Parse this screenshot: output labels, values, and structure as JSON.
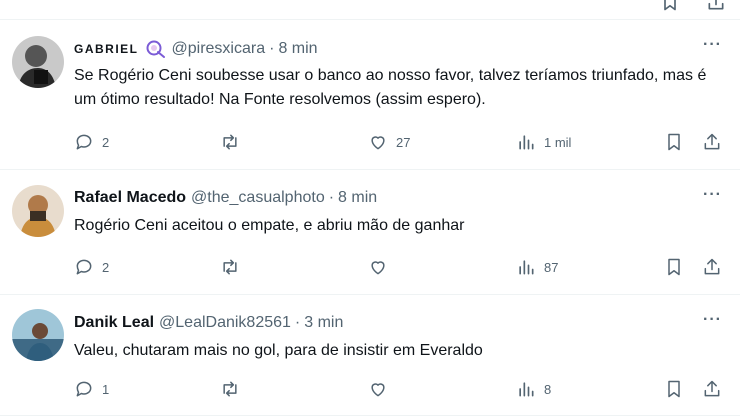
{
  "tweets": [
    {
      "name": "GABRIEL",
      "handle": "@piresxicara",
      "separator": "·",
      "time": "8 min",
      "text": "Se Rogério Ceni soubesse usar o banco ao nosso favor, talvez teríamos triunfado, mas é um ótimo resultado! Na Fonte resolvemos (assim espero).",
      "replies": "2",
      "retweets": "",
      "likes": "27",
      "views": "1 mil",
      "more_label": "···"
    },
    {
      "name": "Rafael Macedo",
      "handle": "@the_casualphoto",
      "separator": "·",
      "time": "8 min",
      "text": "Rogério Ceni aceitou o empate, e abriu mão de ganhar",
      "replies": "2",
      "retweets": "",
      "likes": "",
      "views": "87",
      "more_label": "···"
    },
    {
      "name": "Danik Leal",
      "handle": "@LealDanik82561",
      "separator": "·",
      "time": "3 min",
      "text": "Valeu, chutaram mais no gol, para de insistir em Everaldo",
      "replies": "1",
      "retweets": "",
      "likes": "",
      "views": "8",
      "more_label": "···"
    }
  ],
  "colors": {
    "text": "#0f1419",
    "secondary": "#536471",
    "border": "#eff3f4",
    "badge": "#7b5bd6"
  }
}
